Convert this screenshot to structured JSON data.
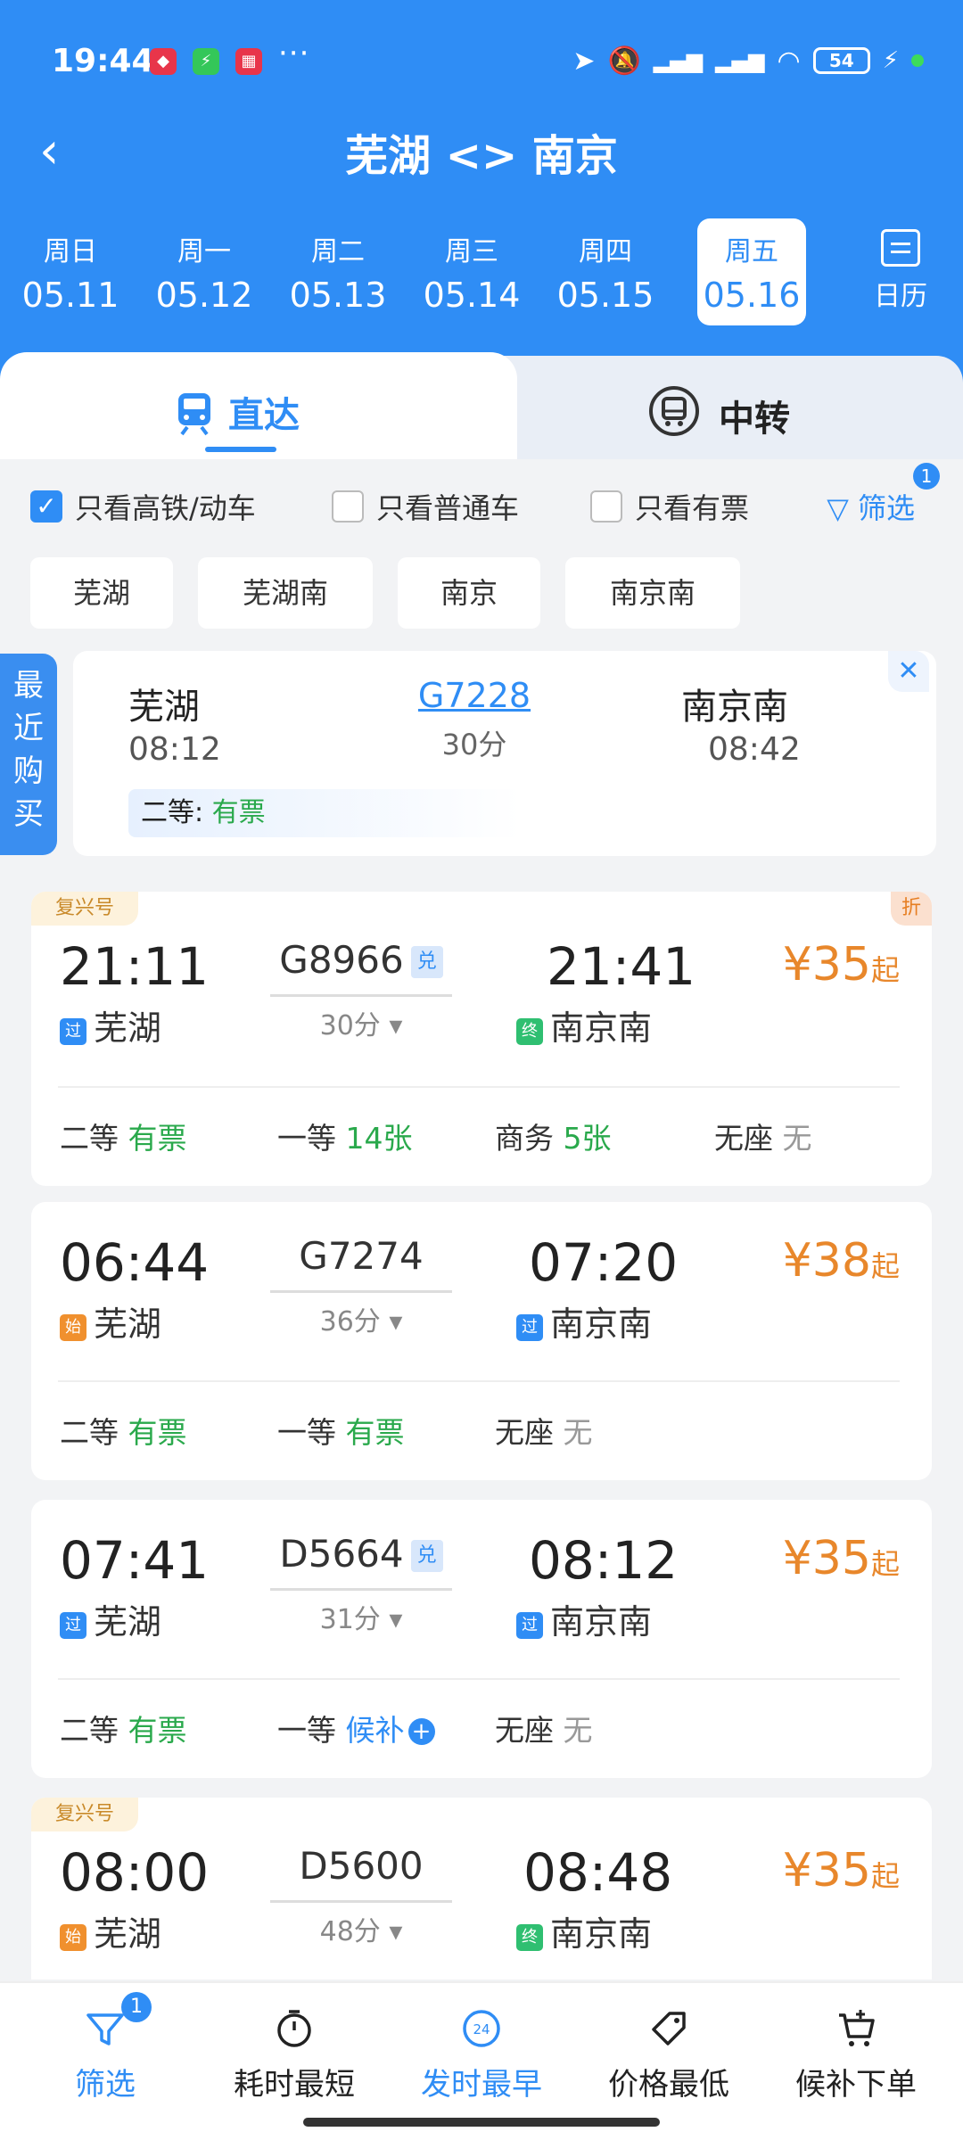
{
  "status": {
    "time": "19:44",
    "battery": "54"
  },
  "nav": {
    "title": "芜湖 <> 南京"
  },
  "days": [
    {
      "weekday": "周日",
      "date": "05.11"
    },
    {
      "weekday": "周一",
      "date": "05.12"
    },
    {
      "weekday": "周二",
      "date": "05.13"
    },
    {
      "weekday": "周三",
      "date": "05.14"
    },
    {
      "weekday": "周四",
      "date": "05.15"
    },
    {
      "weekday": "周五",
      "date": "05.16"
    }
  ],
  "calendar_label": "日历",
  "tabs": {
    "direct": "直达",
    "transfer": "中转"
  },
  "filters": {
    "high_speed": "只看高铁/动车",
    "normal": "只看普通车",
    "available": "只看有票",
    "screen": "筛选",
    "screen_count": "1"
  },
  "stations": [
    "芜湖",
    "芜湖南",
    "南京",
    "南京南"
  ],
  "recent": {
    "tab_label": "最近购买",
    "from": "芜湖",
    "from_time": "08:12",
    "train": "G7228",
    "duration": "30分",
    "to": "南京南",
    "to_time": "08:42",
    "seat": "二等:",
    "status": "有票",
    "close": "✕"
  },
  "trains": [
    {
      "badge": "复兴号",
      "zhe": "折",
      "dep_time": "21:11",
      "arr_time": "21:41",
      "number": "G8966",
      "dui": "兑",
      "duration": "30分 ▾",
      "from_tag": "过",
      "from": "芜湖",
      "to_tag": "终",
      "to": "南京南",
      "price": "¥35",
      "price_suffix": "起",
      "seats": [
        {
          "name": "二等",
          "val": "有票"
        },
        {
          "name": "一等",
          "val": "14张"
        },
        {
          "name": "商务",
          "val": "5张"
        },
        {
          "name": "无座",
          "val": "无"
        }
      ]
    },
    {
      "dep_time": "06:44",
      "arr_time": "07:20",
      "number": "G7274",
      "duration": "36分 ▾",
      "from_tag": "始",
      "from": "芜湖",
      "to_tag": "过",
      "to": "南京南",
      "price": "¥38",
      "price_suffix": "起",
      "seats": [
        {
          "name": "二等",
          "val": "有票"
        },
        {
          "name": "一等",
          "val": "有票"
        },
        {
          "name": "无座",
          "val": "无"
        }
      ]
    },
    {
      "dep_time": "07:41",
      "arr_time": "08:12",
      "number": "D5664",
      "dui": "兑",
      "duration": "31分 ▾",
      "from_tag": "过",
      "from": "芜湖",
      "to_tag": "过",
      "to": "南京南",
      "price": "¥35",
      "price_suffix": "起",
      "seats": [
        {
          "name": "二等",
          "val": "有票"
        },
        {
          "name": "一等",
          "val": "候补"
        },
        {
          "name": "无座",
          "val": "无"
        }
      ]
    },
    {
      "badge": "复兴号",
      "dep_time": "08:00",
      "arr_time": "08:48",
      "number": "D5600",
      "duration": "48分 ▾",
      "from_tag": "始",
      "from": "芜湖",
      "to_tag": "终",
      "to": "南京南",
      "price": "¥35",
      "price_suffix": "起"
    }
  ],
  "bottom": [
    {
      "label": "筛选",
      "icon": "filter-icon",
      "badge": "1"
    },
    {
      "label": "耗时最短",
      "icon": "timer-icon"
    },
    {
      "label": "发时最早",
      "icon": "clock-24-icon"
    },
    {
      "label": "价格最低",
      "icon": "price-tag-icon"
    },
    {
      "label": "候补下单",
      "icon": "cart-icon"
    }
  ],
  "colors": {
    "primary": "#2f8df5",
    "green": "#2aa94c",
    "orange": "#e8872b"
  }
}
